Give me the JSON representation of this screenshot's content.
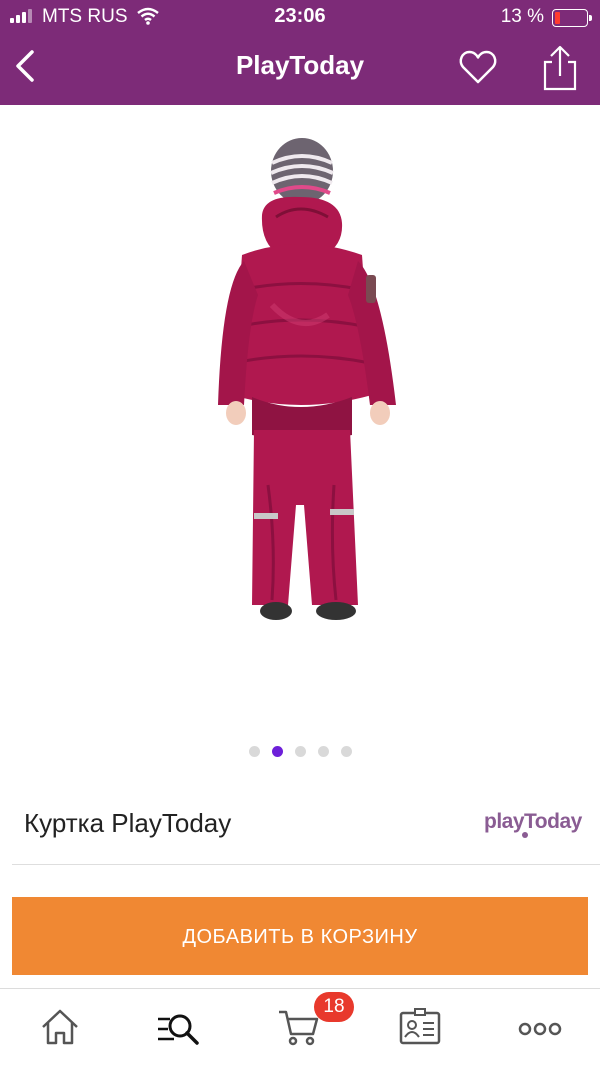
{
  "status_bar": {
    "carrier": "MTS RUS",
    "time": "23:06",
    "battery_percent": "13 %"
  },
  "nav": {
    "title": "PlayToday"
  },
  "gallery": {
    "pages": 5,
    "active_index": 1
  },
  "product": {
    "name": "Куртка PlayToday",
    "brand_logo_text": "playToday"
  },
  "actions": {
    "add_to_cart_label": "ДОБАВИТЬ В КОРЗИНУ"
  },
  "tabbar": {
    "cart_badge": "18"
  },
  "colors": {
    "header_bg": "#7d2b78",
    "cart_button": "#f08833",
    "badge": "#e8392c",
    "active_dot": "#6d1fd9",
    "jacket": "#b0184f"
  }
}
